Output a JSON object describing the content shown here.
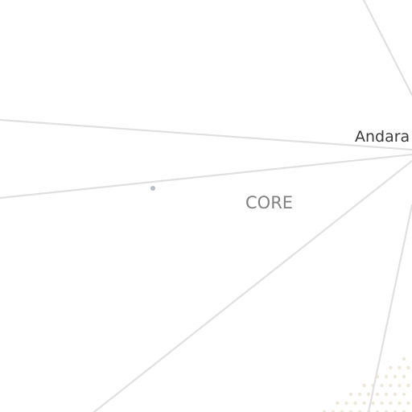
{
  "map": {
    "labels": {
      "city": "Andara",
      "area": "CORE"
    },
    "colors": {
      "background": "#ffffff",
      "road": "#e0e0e0",
      "point": "#b8bfc9",
      "dots": "#ece9d8",
      "city_text": "#3a3a3a",
      "area_text": "#808080"
    },
    "icons": {
      "point_marker": "point-marker-icon",
      "dot_pattern": "dotted-area-pattern"
    }
  }
}
